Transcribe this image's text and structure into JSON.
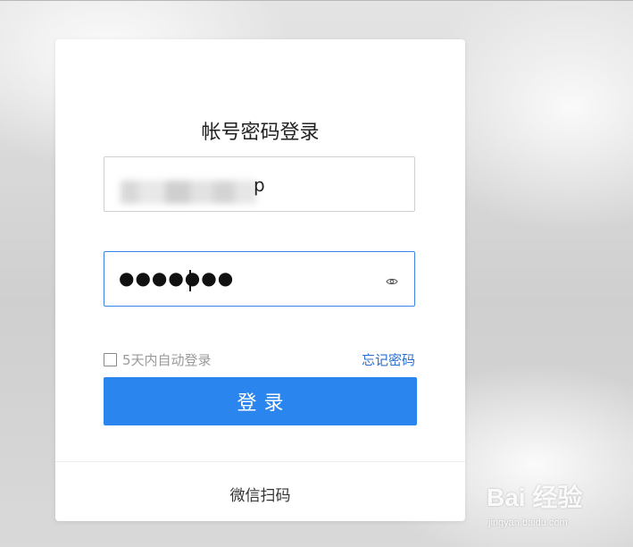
{
  "login": {
    "title": "帐号密码登录",
    "username_visible_suffix": "p",
    "password_masked": "●●●●●●●",
    "remember_label": "5天内自动登录",
    "forgot_label": "忘记密码",
    "submit_label": "登录",
    "wechat_label": "微信扫码"
  },
  "watermark": {
    "logo": "Bai 经验",
    "url": "jingyan.baidu.com"
  },
  "icons": {
    "password_toggle": "eye-icon",
    "remember": "checkbox"
  },
  "colors": {
    "accent": "#2a86ee",
    "link": "#2a6fd1",
    "focus_border": "#3a86e6"
  }
}
